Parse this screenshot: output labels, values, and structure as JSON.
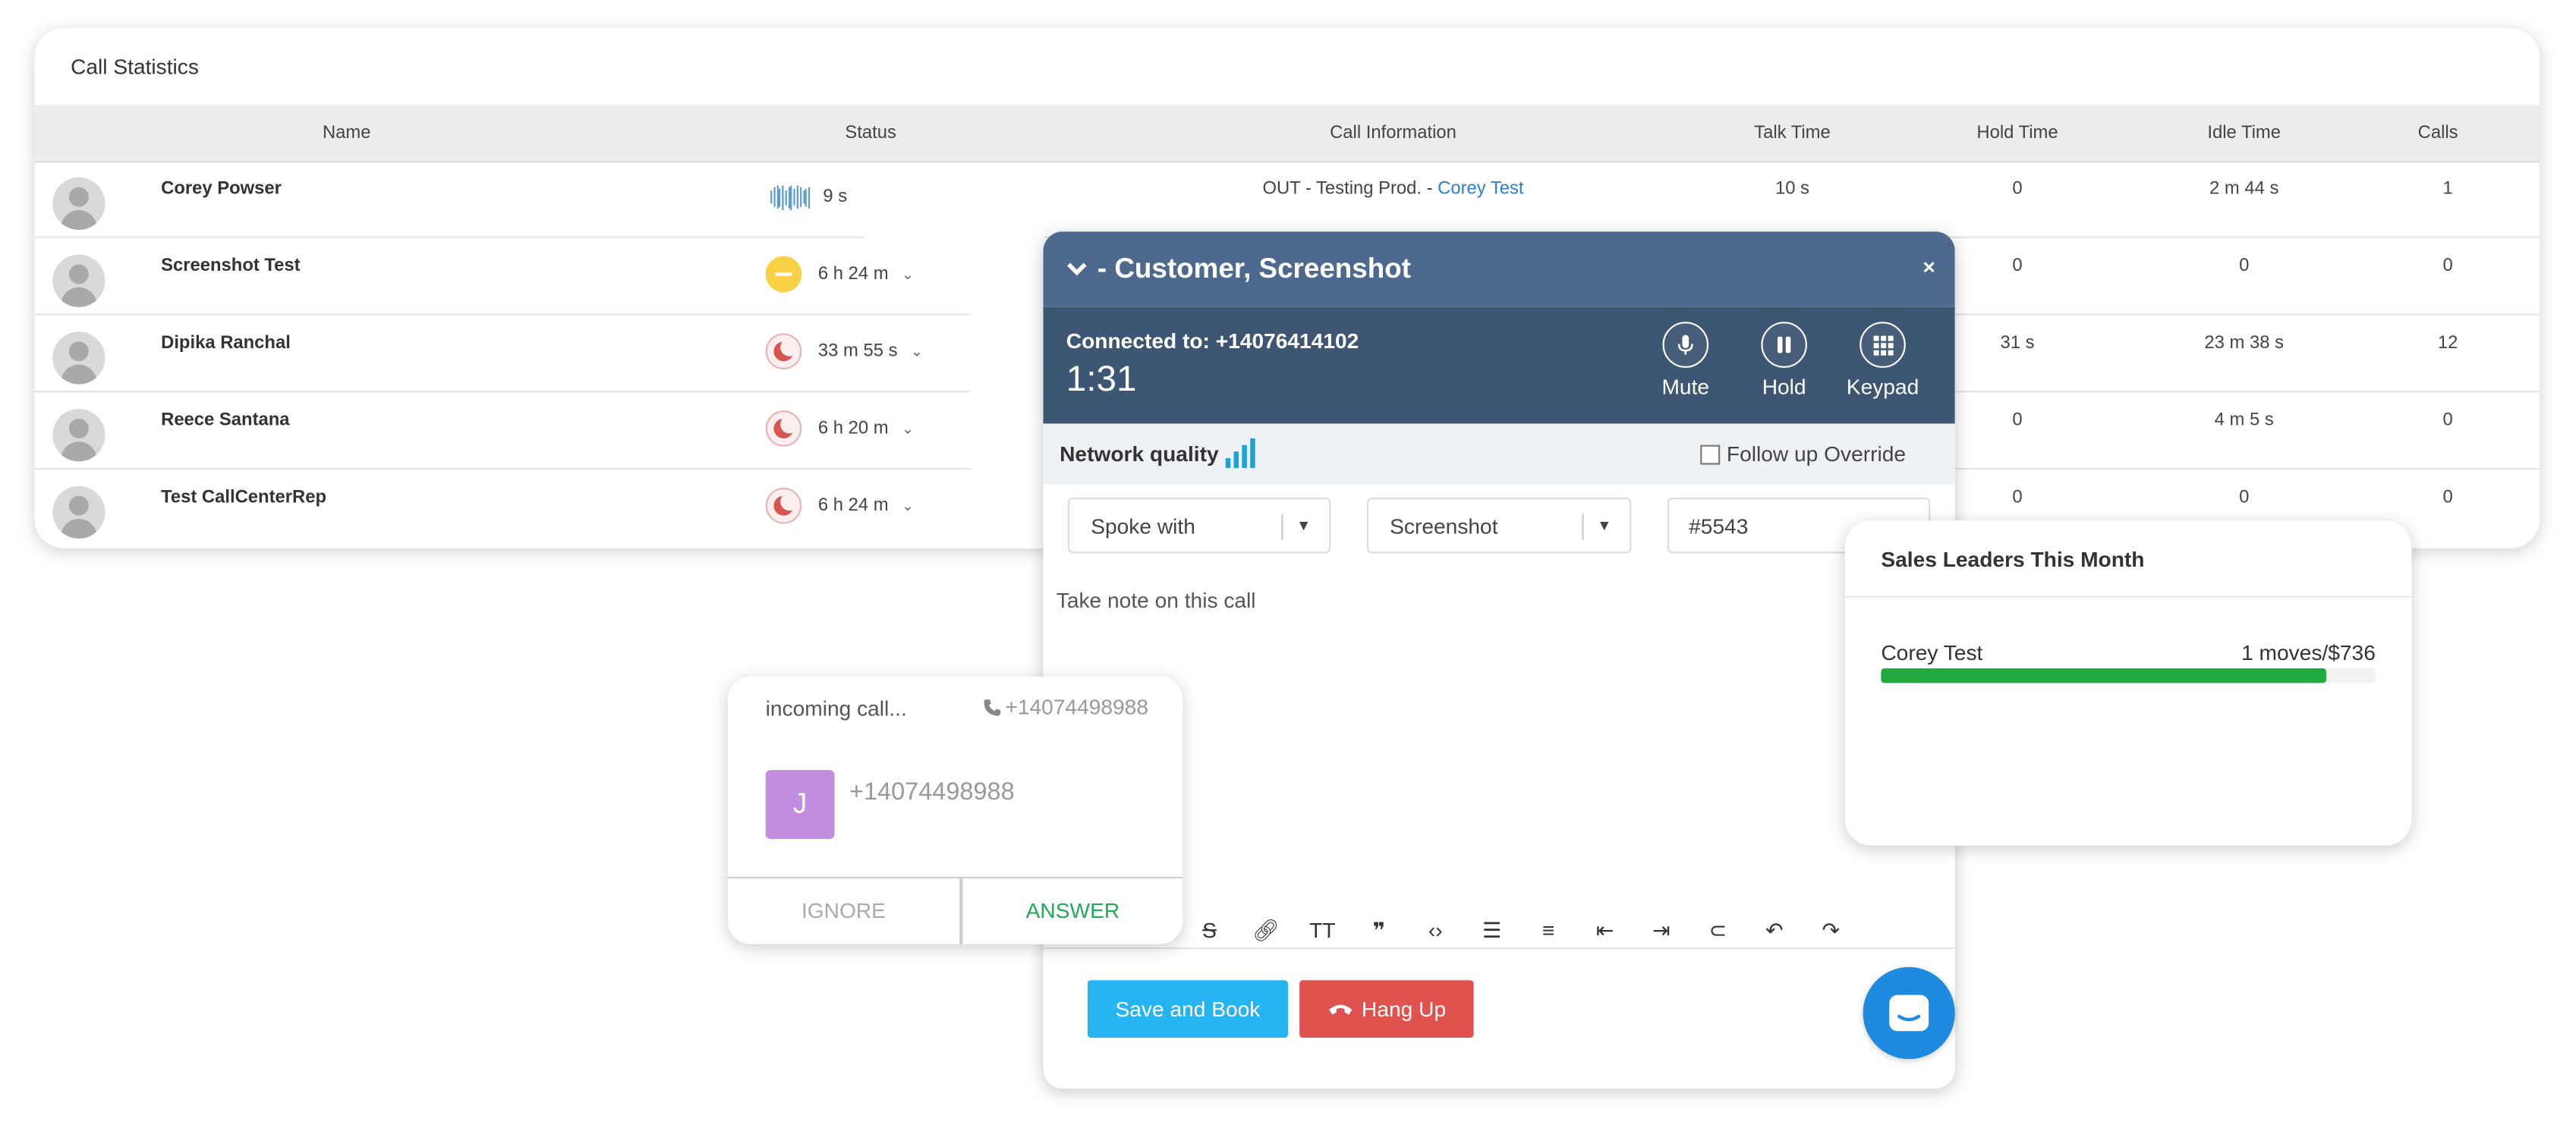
{
  "stats": {
    "title": "Call Statistics",
    "columns": [
      "Name",
      "Status",
      "Call Information",
      "Talk Time",
      "Hold Time",
      "Idle Time",
      "Calls"
    ],
    "rows": [
      {
        "name": "Corey Powser",
        "status_icon": "sound-wave-icon",
        "status_time": "9 s",
        "call_prefix": "OUT - Testing Prod. - ",
        "call_link": "Corey Test",
        "talk": "10 s",
        "hold": "0",
        "idle": "2 m 44 s",
        "calls": "1"
      },
      {
        "name": "Screenshot Test",
        "status_icon": "busy-icon",
        "status_time": "6 h 24 m",
        "hold": "0",
        "idle": "0",
        "calls": "0"
      },
      {
        "name": "Dipika Ranchal",
        "status_icon": "moon-icon",
        "status_time": "33 m 55 s",
        "hold": "31 s",
        "idle": "23 m 38 s",
        "calls": "12"
      },
      {
        "name": "Reece Santana",
        "status_icon": "moon-icon",
        "status_time": "6 h 20 m",
        "hold": "0",
        "idle": "4 m 5 s",
        "calls": "0"
      },
      {
        "name": "Test CallCenterRep",
        "status_icon": "moon-icon",
        "status_time": "6 h 24 m",
        "hold": "0",
        "idle": "0",
        "calls": "0"
      }
    ]
  },
  "call": {
    "title": "- Customer, Screenshot",
    "close": "×",
    "connected": "Connected to: +14076414102",
    "timer": "1:31",
    "mute": "Mute",
    "hold": "Hold",
    "keypad": "Keypad",
    "network_label": "Network quality",
    "network_level": 4,
    "followup": "Follow up Override",
    "select1": "Spoke with",
    "select2": "Screenshot",
    "ticket": "#5543",
    "note_placeholder": "Take note on this call",
    "save": "Save and Book",
    "hangup": "Hang Up",
    "colors": {
      "header": "#4d6a8e",
      "bar": "#3d5673",
      "save": "#27b4f2",
      "hangup": "#e0524e"
    }
  },
  "incoming": {
    "label": "incoming call...",
    "number_top": "+14074498988",
    "avatar_letter": "J",
    "number": "+14074498988",
    "ignore": "IGNORE",
    "answer": "ANSWER",
    "avatar_color": "#c48ee0"
  },
  "leaders": {
    "title": "Sales Leaders This Month",
    "items": [
      {
        "name": "Corey Test",
        "value": "1 moves/$736",
        "progress_fraction": 0.9
      }
    ],
    "bar_color": "#22a93f"
  }
}
